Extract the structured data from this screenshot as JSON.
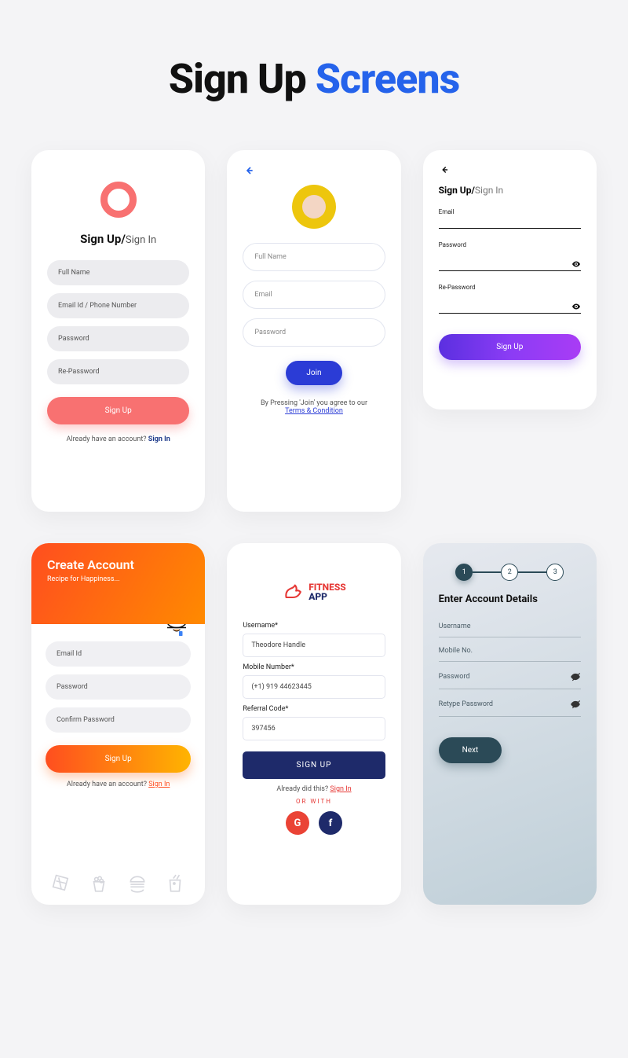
{
  "title": {
    "t1": "Sign Up ",
    "t2": "Screens"
  },
  "s1": {
    "tab_signup": "Sign Up/",
    "tab_signin": "Sign In",
    "fullname": "Full Name",
    "email": "Email Id / Phone Number",
    "password": "Password",
    "repassword": "Re-Password",
    "signup_btn": "Sign Up",
    "already": "Already have an account? ",
    "signin_link": "Sign In"
  },
  "s2": {
    "fullname": "Full Name",
    "email": "Email",
    "password": "Password",
    "join_btn": "Join",
    "agree_text": "By Pressing 'Join' you agree to our",
    "terms_link": "Terms & Condition"
  },
  "s3": {
    "tab_signup": "Sign Up/",
    "tab_signin": "Sign In",
    "email_label": "Email",
    "password_label": "Password",
    "repassword_label": "Re-Password",
    "signup_btn": "Sign Up"
  },
  "s4": {
    "heading": "Create Account",
    "subheading": "Recipe for Happiness...",
    "email": "Email Id",
    "password": "Password",
    "confirm": "Confirm Password",
    "signup_btn": "Sign Up",
    "already": "Already have an account? ",
    "signin_link": "Sign In"
  },
  "s5": {
    "logo1": "FITNESS",
    "logo2": "APP",
    "username_label": "Username*",
    "username_value": "Theodore Handle",
    "mobile_label": "Mobile Number*",
    "mobile_value": "(+1) 919 44623445",
    "referral_label": "Referral Code*",
    "referral_value": "397456",
    "signup_btn": "SIGN UP",
    "already": "Already did this? ",
    "signin_link": "Sign In",
    "orwith": "OR WITH",
    "g": "G",
    "f": "f"
  },
  "s6": {
    "step1": "1",
    "step2": "2",
    "step3": "3",
    "heading": "Enter Account Details",
    "username": "Username",
    "mobile": "Mobile No.",
    "password": "Password",
    "retype": "Retype Password",
    "next_btn": "Next"
  }
}
